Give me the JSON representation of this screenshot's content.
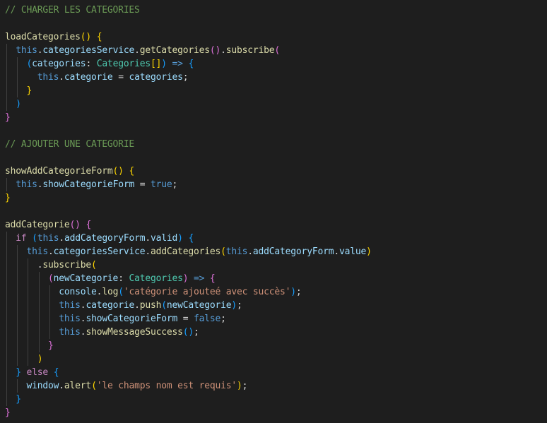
{
  "editor": {
    "lines": [
      [
        {
          "t": "// CHARGER LES CATEGORIES",
          "c": "c-comment"
        }
      ],
      [],
      [
        {
          "t": "loadCategories",
          "c": "c-fn"
        },
        {
          "t": "()",
          "c": "b1"
        },
        {
          "t": " ",
          "c": "c-punc"
        },
        {
          "t": "{",
          "c": "b1"
        }
      ],
      [
        {
          "t": "  ",
          "c": "c-punc"
        },
        {
          "t": "this",
          "c": "c-this"
        },
        {
          "t": ".",
          "c": "c-punc"
        },
        {
          "t": "categoriesService",
          "c": "c-prop"
        },
        {
          "t": ".",
          "c": "c-punc"
        },
        {
          "t": "getCategories",
          "c": "c-fn"
        },
        {
          "t": "()",
          "c": "b2"
        },
        {
          "t": ".",
          "c": "c-punc"
        },
        {
          "t": "subscribe",
          "c": "c-fn"
        },
        {
          "t": "(",
          "c": "b2"
        }
      ],
      [
        {
          "t": "    ",
          "c": "c-punc"
        },
        {
          "t": "(",
          "c": "b3"
        },
        {
          "t": "categories",
          "c": "c-prop"
        },
        {
          "t": ": ",
          "c": "c-punc"
        },
        {
          "t": "Categories",
          "c": "c-type"
        },
        {
          "t": "[]",
          "c": "b1"
        },
        {
          "t": ")",
          "c": "b3"
        },
        {
          "t": " ",
          "c": "c-punc"
        },
        {
          "t": "=>",
          "c": "c-this"
        },
        {
          "t": " ",
          "c": "c-punc"
        },
        {
          "t": "{",
          "c": "b3"
        }
      ],
      [
        {
          "t": "      ",
          "c": "c-punc"
        },
        {
          "t": "this",
          "c": "c-this"
        },
        {
          "t": ".",
          "c": "c-punc"
        },
        {
          "t": "categorie",
          "c": "c-prop"
        },
        {
          "t": " = ",
          "c": "c-punc"
        },
        {
          "t": "categories",
          "c": "c-prop"
        },
        {
          "t": ";",
          "c": "c-punc"
        }
      ],
      [
        {
          "t": "    ",
          "c": "c-punc"
        },
        {
          "t": "}",
          "c": "b1"
        }
      ],
      [
        {
          "t": "  ",
          "c": "c-punc"
        },
        {
          "t": ")",
          "c": "b3"
        }
      ],
      [
        {
          "t": "}",
          "c": "b2"
        }
      ],
      [],
      [
        {
          "t": "// AJOUTER UNE CATEGORIE",
          "c": "c-comment"
        }
      ],
      [],
      [
        {
          "t": "showAddCategorieForm",
          "c": "c-fn"
        },
        {
          "t": "()",
          "c": "b1"
        },
        {
          "t": " ",
          "c": "c-punc"
        },
        {
          "t": "{",
          "c": "b1"
        }
      ],
      [
        {
          "t": "  ",
          "c": "c-punc"
        },
        {
          "t": "this",
          "c": "c-this"
        },
        {
          "t": ".",
          "c": "c-punc"
        },
        {
          "t": "showCategorieForm",
          "c": "c-prop"
        },
        {
          "t": " = ",
          "c": "c-punc"
        },
        {
          "t": "true",
          "c": "c-bool"
        },
        {
          "t": ";",
          "c": "c-punc"
        }
      ],
      [
        {
          "t": "}",
          "c": "b1"
        }
      ],
      [],
      [
        {
          "t": "addCategorie",
          "c": "c-fn"
        },
        {
          "t": "()",
          "c": "b2"
        },
        {
          "t": " ",
          "c": "c-punc"
        },
        {
          "t": "{",
          "c": "b2"
        }
      ],
      [
        {
          "t": "  ",
          "c": "c-punc"
        },
        {
          "t": "if",
          "c": "c-ctrl"
        },
        {
          "t": " ",
          "c": "c-punc"
        },
        {
          "t": "(",
          "c": "b3"
        },
        {
          "t": "this",
          "c": "c-this"
        },
        {
          "t": ".",
          "c": "c-punc"
        },
        {
          "t": "addCategoryForm",
          "c": "c-prop"
        },
        {
          "t": ".",
          "c": "c-punc"
        },
        {
          "t": "valid",
          "c": "c-prop"
        },
        {
          "t": ")",
          "c": "b3"
        },
        {
          "t": " ",
          "c": "c-punc"
        },
        {
          "t": "{",
          "c": "b3"
        }
      ],
      [
        {
          "t": "    ",
          "c": "c-punc"
        },
        {
          "t": "this",
          "c": "c-this"
        },
        {
          "t": ".",
          "c": "c-punc"
        },
        {
          "t": "categoriesService",
          "c": "c-prop"
        },
        {
          "t": ".",
          "c": "c-punc"
        },
        {
          "t": "addCategories",
          "c": "c-fn"
        },
        {
          "t": "(",
          "c": "b1"
        },
        {
          "t": "this",
          "c": "c-this"
        },
        {
          "t": ".",
          "c": "c-punc"
        },
        {
          "t": "addCategoryForm",
          "c": "c-prop"
        },
        {
          "t": ".",
          "c": "c-punc"
        },
        {
          "t": "value",
          "c": "c-prop"
        },
        {
          "t": ")",
          "c": "b1"
        }
      ],
      [
        {
          "t": "      ",
          "c": "c-punc"
        },
        {
          "t": ".",
          "c": "c-punc"
        },
        {
          "t": "subscribe",
          "c": "c-fn"
        },
        {
          "t": "(",
          "c": "b1"
        }
      ],
      [
        {
          "t": "        ",
          "c": "c-punc"
        },
        {
          "t": "(",
          "c": "b2"
        },
        {
          "t": "newCategorie",
          "c": "c-prop"
        },
        {
          "t": ": ",
          "c": "c-punc"
        },
        {
          "t": "Categories",
          "c": "c-type"
        },
        {
          "t": ")",
          "c": "b2"
        },
        {
          "t": " ",
          "c": "c-punc"
        },
        {
          "t": "=>",
          "c": "c-this"
        },
        {
          "t": " ",
          "c": "c-punc"
        },
        {
          "t": "{",
          "c": "b2"
        }
      ],
      [
        {
          "t": "          ",
          "c": "c-punc"
        },
        {
          "t": "console",
          "c": "c-prop"
        },
        {
          "t": ".",
          "c": "c-punc"
        },
        {
          "t": "log",
          "c": "c-fn"
        },
        {
          "t": "(",
          "c": "b3"
        },
        {
          "t": "'catégorie ajouteé avec succès'",
          "c": "c-str"
        },
        {
          "t": ")",
          "c": "b3"
        },
        {
          "t": ";",
          "c": "c-punc"
        }
      ],
      [
        {
          "t": "          ",
          "c": "c-punc"
        },
        {
          "t": "this",
          "c": "c-this"
        },
        {
          "t": ".",
          "c": "c-punc"
        },
        {
          "t": "categorie",
          "c": "c-prop"
        },
        {
          "t": ".",
          "c": "c-punc"
        },
        {
          "t": "push",
          "c": "c-fn"
        },
        {
          "t": "(",
          "c": "b3"
        },
        {
          "t": "newCategorie",
          "c": "c-prop"
        },
        {
          "t": ")",
          "c": "b3"
        },
        {
          "t": ";",
          "c": "c-punc"
        }
      ],
      [
        {
          "t": "          ",
          "c": "c-punc"
        },
        {
          "t": "this",
          "c": "c-this"
        },
        {
          "t": ".",
          "c": "c-punc"
        },
        {
          "t": "showCategorieForm",
          "c": "c-prop"
        },
        {
          "t": " = ",
          "c": "c-punc"
        },
        {
          "t": "false",
          "c": "c-bool"
        },
        {
          "t": ";",
          "c": "c-punc"
        }
      ],
      [
        {
          "t": "          ",
          "c": "c-punc"
        },
        {
          "t": "this",
          "c": "c-this"
        },
        {
          "t": ".",
          "c": "c-punc"
        },
        {
          "t": "showMessageSuccess",
          "c": "c-fn"
        },
        {
          "t": "()",
          "c": "b3"
        },
        {
          "t": ";",
          "c": "c-punc"
        }
      ],
      [
        {
          "t": "        ",
          "c": "c-punc"
        },
        {
          "t": "}",
          "c": "b2"
        }
      ],
      [
        {
          "t": "      ",
          "c": "c-punc"
        },
        {
          "t": ")",
          "c": "b1"
        }
      ],
      [
        {
          "t": "  ",
          "c": "c-punc"
        },
        {
          "t": "}",
          "c": "b3"
        },
        {
          "t": " ",
          "c": "c-punc"
        },
        {
          "t": "else",
          "c": "c-ctrl"
        },
        {
          "t": " ",
          "c": "c-punc"
        },
        {
          "t": "{",
          "c": "b3"
        }
      ],
      [
        {
          "t": "    ",
          "c": "c-punc"
        },
        {
          "t": "window",
          "c": "c-prop"
        },
        {
          "t": ".",
          "c": "c-punc"
        },
        {
          "t": "alert",
          "c": "c-fn"
        },
        {
          "t": "(",
          "c": "b1"
        },
        {
          "t": "'le champs nom est requis'",
          "c": "c-str"
        },
        {
          "t": ")",
          "c": "b1"
        },
        {
          "t": ";",
          "c": "c-punc"
        }
      ],
      [
        {
          "t": "  ",
          "c": "c-punc"
        },
        {
          "t": "}",
          "c": "b3"
        }
      ],
      [
        {
          "t": "}",
          "c": "b2"
        }
      ]
    ]
  },
  "colors": {
    "background": "#1e1e1e",
    "comment": "#6a9955",
    "function": "#dcdcaa",
    "keyword": "#569cd6",
    "property": "#9cdcfe",
    "type": "#4ec9b0",
    "control": "#c586c0",
    "string": "#ce9178",
    "bracket1": "#ffd700",
    "bracket2": "#da70d6",
    "bracket3": "#179fff"
  }
}
